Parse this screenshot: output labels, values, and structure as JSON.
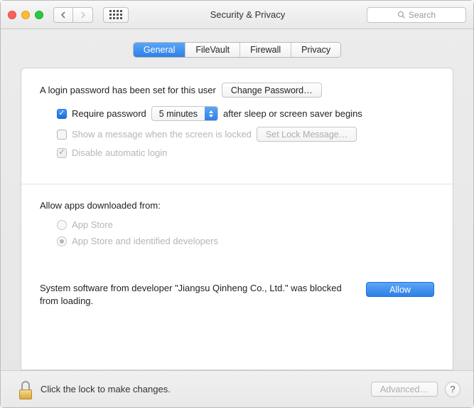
{
  "window": {
    "title": "Security & Privacy"
  },
  "toolbar": {
    "search_placeholder": "Search"
  },
  "tabs": {
    "general": "General",
    "filevault": "FileVault",
    "firewall": "Firewall",
    "privacy": "Privacy"
  },
  "login": {
    "heading": "A login password has been set for this user",
    "change_password": "Change Password…",
    "require_password_label": "Require password",
    "delay_value": "5 minutes",
    "after_sleep": "after sleep or screen saver begins",
    "show_message_label": "Show a message when the screen is locked",
    "set_lock_message": "Set Lock Message…",
    "disable_auto_login": "Disable automatic login"
  },
  "gatekeeper": {
    "heading": "Allow apps downloaded from:",
    "appstore": "App Store",
    "appstore_identified": "App Store and identified developers"
  },
  "blocked": {
    "message": "System software from developer \"Jiangsu Qinheng Co., Ltd.\" was blocked from loading.",
    "allow": "Allow"
  },
  "footer": {
    "lock_text": "Click the lock to make changes.",
    "advanced": "Advanced…",
    "help": "?"
  }
}
